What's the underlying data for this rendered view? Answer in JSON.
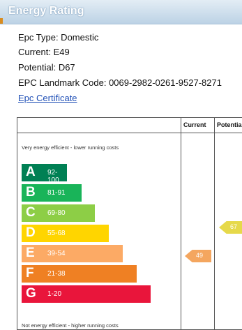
{
  "header": {
    "title": "Energy Rating"
  },
  "details": {
    "epc_type": "Epc Type: Domestic",
    "current": "Current: E49",
    "potential": "Potential: D67",
    "landmark_code": "EPC Landmark Code: 0069-2982-0261-9527-8271",
    "certificate_link": "Epc Certificate"
  },
  "rating_table": {
    "col_current": "Current",
    "col_potential": "Potentia",
    "top_caption": "Very energy efficient - lower running costs",
    "bottom_caption": "Not energy efficient - higher running costs",
    "bands": [
      {
        "letter": "A",
        "range": "92-100",
        "color": "#008054"
      },
      {
        "letter": "B",
        "range": "81-91",
        "color": "#19b459"
      },
      {
        "letter": "C",
        "range": "69-80",
        "color": "#8dce46"
      },
      {
        "letter": "D",
        "range": "55-68",
        "color": "#ffd500"
      },
      {
        "letter": "E",
        "range": "39-54",
        "color": "#fcaa65"
      },
      {
        "letter": "F",
        "range": "21-38",
        "color": "#ef8023"
      },
      {
        "letter": "G",
        "range": "1-20",
        "color": "#e9153b"
      }
    ],
    "current_value": "49",
    "current_color": "#f4a65f",
    "potential_value": "67",
    "potential_color": "#e6d94a"
  }
}
